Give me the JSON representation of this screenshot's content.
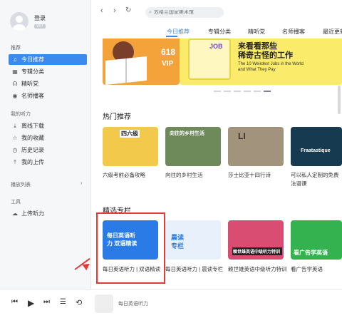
{
  "profile": {
    "login": "登录",
    "vip": "VIP"
  },
  "sidebar": {
    "sections": [
      {
        "title": "推荐"
      },
      {
        "title": "我的听力"
      },
      {
        "title": "播放列表"
      },
      {
        "title": "工具"
      }
    ],
    "items": [
      {
        "label": "今日推荐",
        "icon": "♫"
      },
      {
        "label": "专辑分类",
        "icon": "▦"
      },
      {
        "label": "精听党",
        "icon": "☊"
      },
      {
        "label": "名师播客",
        "icon": "◉"
      },
      {
        "label": "离线下载",
        "icon": "⤓"
      },
      {
        "label": "我的收藏",
        "icon": "☆"
      },
      {
        "label": "历史记录",
        "icon": "◷"
      },
      {
        "label": "我的上传",
        "icon": "⤒"
      },
      {
        "label": "上传听力",
        "icon": "☁"
      }
    ],
    "playlist_chevron": "›"
  },
  "topbar": {
    "search_placeholder": "苏格兰国家美术馆",
    "back": "‹",
    "forward": "›",
    "refresh": "↻",
    "search_icon": "⌕"
  },
  "tabs": [
    "今日推荐",
    "专辑分类",
    "精听党",
    "名师播客",
    "最近更新"
  ],
  "banner": {
    "left_big": "618",
    "left_vip": "VIP",
    "right_job": "JOB",
    "right_title1": "来看看那些",
    "right_title2": "稀奇古怪的工作",
    "right_sub1": "The 10 Weirdest Jobs in the World",
    "right_sub2": "and What They Pay"
  },
  "hot": {
    "title": "热门推荐",
    "cards": [
      {
        "caption": "六级考前必备攻略",
        "text": "四六级",
        "bg": "#f3c94b"
      },
      {
        "caption": "向往的乡村生活",
        "text": "向往的乡村生活",
        "bg": "#6f8a5a"
      },
      {
        "caption": "莎士比亚十四行诗",
        "text": "LI",
        "bg": "#a2937d"
      },
      {
        "caption": "可以私人定制的免费法语课",
        "text": "Fraatastique",
        "bg": "#163a4f"
      }
    ]
  },
  "column": {
    "title": "精选专栏",
    "cards": [
      {
        "caption": "每日英语听力 | 双语精读",
        "text": "每日英语听力 双语精读",
        "bg": "#2a7be6"
      },
      {
        "caption": "每日英语听力 | 晨读专栏",
        "text": "晨读 专栏",
        "bg": "#e8f1fb"
      },
      {
        "caption": "赖世雄英语中级听力特训",
        "text": "赖世雄英语中级听力特训",
        "bg": "#d94d72"
      },
      {
        "caption": "看广告学英语",
        "text": "看广告学英语",
        "bg": "#34b24f"
      }
    ]
  },
  "player": {
    "prev": "⏮",
    "play": "▶",
    "next": "⏭",
    "list": "☰",
    "repeat": "⟲",
    "now_playing": "每日英语听力"
  }
}
